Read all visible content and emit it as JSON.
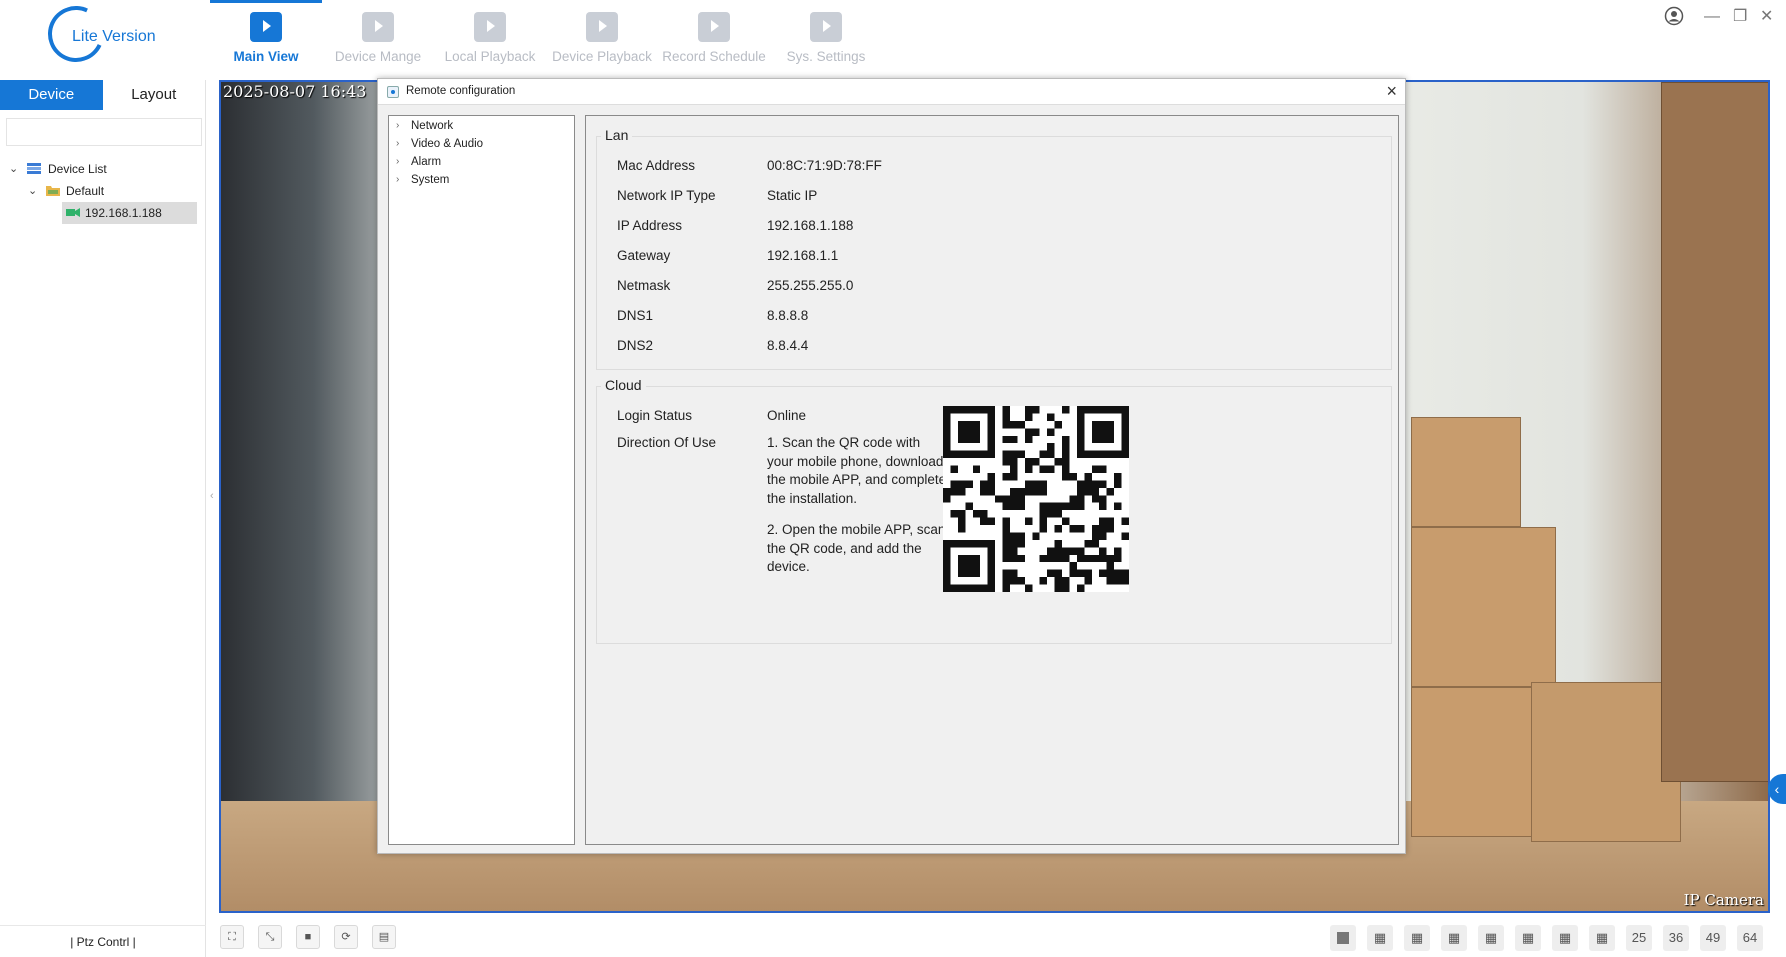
{
  "app": {
    "logo_text": "Lite Version",
    "nav": [
      {
        "label": "Main View",
        "icon": "main-view-icon",
        "active": true
      },
      {
        "label": "Device Mange",
        "icon": "camera-icon",
        "active": false
      },
      {
        "label": "Local Playback",
        "icon": "film-icon",
        "active": false
      },
      {
        "label": "Device Playback",
        "icon": "network-playback-icon",
        "active": false
      },
      {
        "label": "Record Schedule",
        "icon": "record-schedule-icon",
        "active": false
      },
      {
        "label": "Sys. Settings",
        "icon": "monitor-settings-icon",
        "active": false
      }
    ],
    "window_controls": {
      "user": "user-icon",
      "minimize": "—",
      "restore": "❐",
      "close": "✕"
    }
  },
  "left_panel": {
    "tabs": [
      "Device",
      "Layout"
    ],
    "active_tab": "Device",
    "search_placeholder": "",
    "tree": {
      "root": "Device List",
      "group": "Default",
      "device": "192.168.1.188"
    },
    "ptz_label": "| Ptz Contrl |"
  },
  "video": {
    "timestamp": "2025-08-07 16:43",
    "camera_name": "IP Camera"
  },
  "bottom_bar": {
    "layout_buttons": [
      "1",
      "4",
      "6",
      "8",
      "9",
      "10",
      "13",
      "16",
      "25",
      "36",
      "49",
      "64"
    ]
  },
  "dialog": {
    "title": "Remote configuration",
    "menu": [
      "Network",
      "Video & Audio",
      "Alarm",
      "System"
    ],
    "lan": {
      "title": "Lan",
      "fields": [
        {
          "label": "Mac Address",
          "value": "00:8C:71:9D:78:FF"
        },
        {
          "label": "Network IP Type",
          "value": "Static IP"
        },
        {
          "label": "IP Address",
          "value": "192.168.1.188"
        },
        {
          "label": "Gateway",
          "value": "192.168.1.1"
        },
        {
          "label": "Netmask",
          "value": "255.255.255.0"
        },
        {
          "label": "DNS1",
          "value": "8.8.8.8"
        },
        {
          "label": "DNS2",
          "value": "8.8.4.4"
        }
      ]
    },
    "cloud": {
      "title": "Cloud",
      "login_status_label": "Login Status",
      "login_status_value": "Online",
      "direction_label": "Direction Of Use",
      "step1": "1. Scan the QR code with your mobile phone, download the mobile APP, and complete the installation.",
      "step2": "2. Open the mobile APP, scan the QR code, and add the device."
    }
  }
}
